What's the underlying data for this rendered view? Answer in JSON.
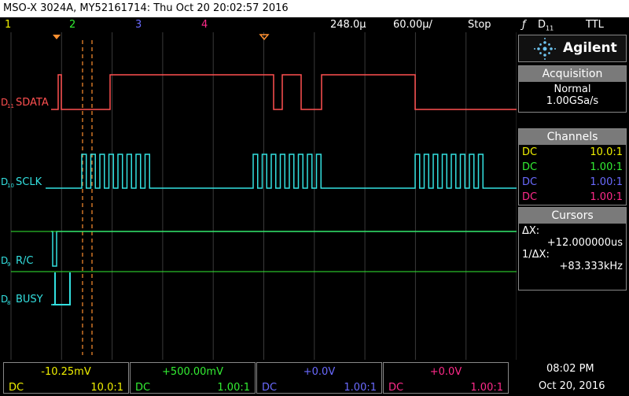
{
  "title": "MSO-X 3024A, MY52161714: Thu Oct 20 20:02:57 2016",
  "statusbar": {
    "ch1": "1",
    "ch2": "2",
    "ch3": "3",
    "ch4": "4",
    "time_div": "248.0µ",
    "timebase": "60.00µ/",
    "run_state": "Stop",
    "trigger_icon": "ƒ",
    "trigger_src_main": "D",
    "trigger_src_sub": "11",
    "trigger_level": "TTL"
  },
  "colors": {
    "ch1": "#f0f000",
    "ch2": "#33ee33",
    "ch3": "#6a6aff",
    "ch4": "#ff2a8a",
    "digital_red": "#ff5050",
    "digital_cyan": "#33e0e0",
    "cursor": "#ff9030"
  },
  "channels_labels": [
    {
      "prefix": "D",
      "sub": "11",
      "name": "SDATA"
    },
    {
      "prefix": "D",
      "sub": "10",
      "name": "SCLK"
    },
    {
      "prefix": "D",
      "sub": "9",
      "name": "R/C"
    },
    {
      "prefix": "D",
      "sub": "8",
      "name": "BUSY"
    }
  ],
  "panel": {
    "brand": "Agilent",
    "acquisition": {
      "header": "Acquisition",
      "mode": "Normal",
      "rate": "1.00GSa/s"
    },
    "channels": {
      "header": "Channels",
      "rows": [
        {
          "coupling": "DC",
          "probe": "10.0:1"
        },
        {
          "coupling": "DC",
          "probe": "1.00:1"
        },
        {
          "coupling": "DC",
          "probe": "1.00:1"
        },
        {
          "coupling": "DC",
          "probe": "1.00:1"
        }
      ]
    },
    "cursors": {
      "header": "Cursors",
      "dx_label": "ΔX:",
      "dx_value": "+12.000000us",
      "inv_label": "1/ΔX:",
      "inv_value": "+83.333kHz"
    }
  },
  "bottom": {
    "ch1": {
      "value": "-10.25mV",
      "coupling": "DC",
      "probe": "10.0:1"
    },
    "ch2": {
      "value": "+500.00mV",
      "coupling": "DC",
      "probe": "1.00:1"
    },
    "ch3": {
      "value": "+0.0V",
      "coupling": "DC",
      "probe": "1.00:1"
    },
    "ch4": {
      "value": "+0.0V",
      "coupling": "DC",
      "probe": "1.00:1"
    },
    "time": "08:02 PM",
    "date": "Oct 20, 2016"
  }
}
